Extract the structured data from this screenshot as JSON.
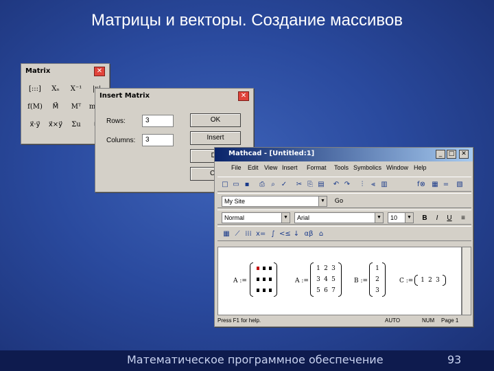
{
  "slide": {
    "title": "Матрицы и векторы. Создание массивов",
    "footer": "Математическое программное обеспечение",
    "page_number": "93"
  },
  "matrix_palette": {
    "title": "Matrix",
    "buttons": [
      "[:::]",
      "Xₙ",
      "X⁻¹",
      "|x|",
      "f(M)",
      "M⃗",
      "Mᵀ",
      "m..n",
      "x⃗·y⃗",
      "x⃗×y⃗",
      "Σu",
      "⧉"
    ]
  },
  "insert_matrix": {
    "title": "Insert Matrix",
    "rows_label": "Rows:",
    "rows_value": "3",
    "columns_label": "Columns:",
    "columns_value": "3",
    "ok_label": "OK",
    "insert_label": "Insert",
    "delete_label": "De",
    "cancel_label": "Car"
  },
  "mathcad": {
    "title": "Mathcad - [Untitled:1]",
    "menu": [
      "File",
      "Edit",
      "View",
      "Insert",
      "Format",
      "Tools",
      "Symbolics",
      "Window",
      "Help"
    ],
    "url_combo": "My Site",
    "go_label": "Go",
    "style_combo": "Normal",
    "font_combo": "Arial",
    "size_combo": "10",
    "bold": "B",
    "italic": "I",
    "underline": "U",
    "status_help": "Press F1 for help.",
    "status_auto": "AUTO",
    "status_num": "NUM",
    "status_page": "Page 1",
    "math": {
      "a_placeholder_label": "A :=",
      "a_label": "A :=",
      "a_values": [
        [
          "1",
          "2",
          "3"
        ],
        [
          "3",
          "4",
          "5"
        ],
        [
          "5",
          "6",
          "7"
        ]
      ],
      "b_label": "B :=",
      "b_values": [
        "1",
        "2",
        "3"
      ],
      "c_label": "C :=",
      "c_values": [
        "1",
        "2",
        "3"
      ]
    }
  }
}
